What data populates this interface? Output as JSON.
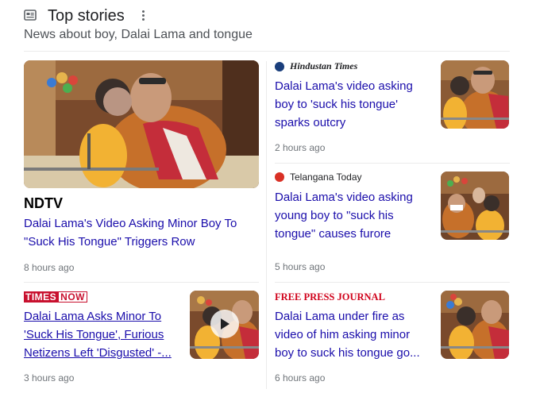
{
  "section": {
    "title": "Top stories",
    "subtitle": "News about boy, Dalai Lama and tongue"
  },
  "stories": [
    {
      "source": "NDTV",
      "headline": "Dalai Lama's Video Asking Minor Boy To \"Suck His Tongue\" Triggers Row",
      "time": "8 hours ago"
    },
    {
      "source": "Hindustan Times",
      "headline": "Dalai Lama's video asking boy to 'suck his tongue' sparks outcry",
      "time": "2 hours ago"
    },
    {
      "source": "Telangana Today",
      "headline": "Dalai Lama's video asking young boy to \"suck his tongue\" causes furore",
      "time": "5 hours ago"
    },
    {
      "source": "TIMESNOW",
      "source_parts": [
        "TIMES",
        "NOW"
      ],
      "headline": "Dalai Lama Asks Minor To 'Suck His Tongue', Furious Netizens Left 'Disgusted' -...",
      "time": "3 hours ago",
      "has_video": true
    },
    {
      "source": "FREE PRESS JOURNAL",
      "headline": "Dalai Lama under fire as video of him asking minor boy to suck his tongue go...",
      "time": "6 hours ago"
    }
  ],
  "colors": {
    "link": "#1a0dab",
    "meta": "#70757a",
    "times_now_red": "#c8102e",
    "free_press_red": "#d0021b"
  },
  "icons": [
    "news-icon",
    "more-options-icon",
    "play-icon"
  ]
}
